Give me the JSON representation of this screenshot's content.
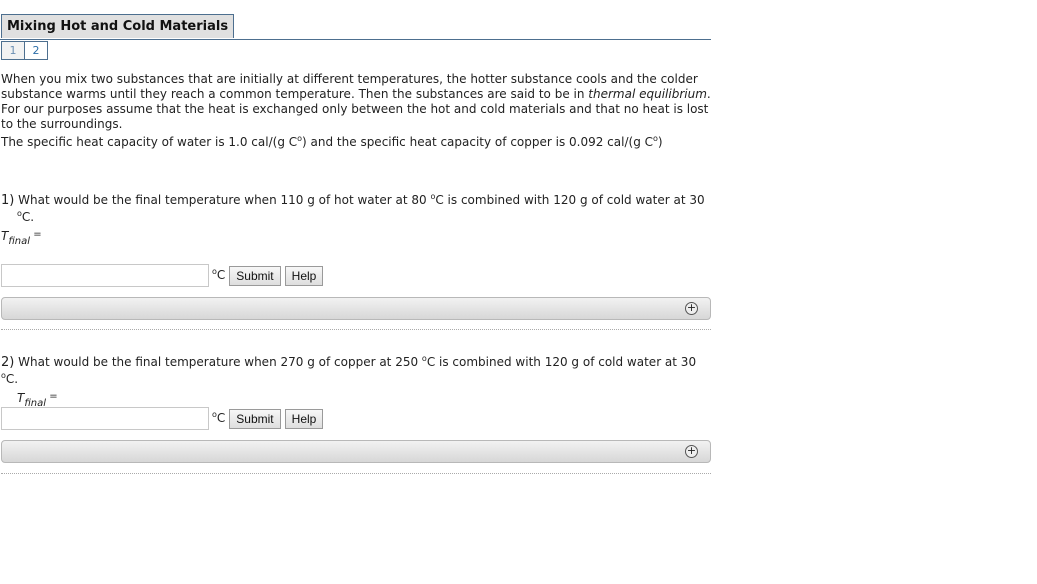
{
  "header": {
    "title": "Mixing Hot and Cold Materials"
  },
  "parts": [
    {
      "label": "1",
      "active": true
    },
    {
      "label": "2",
      "active": false
    }
  ],
  "intro": {
    "p1_before": "When you mix two substances that are initially at different temperatures, the hotter substance cools and the colder substance warms until they reach a common temperature. Then the substances are said to be in ",
    "p1_italic": "thermal equilibrium",
    "p1_after": ". For our purposes assume that the heat is exchanged only between the hot and cold materials and that no heat is lost to the surroundings.",
    "p2_a": "The specific heat capacity of water is 1.0 cal/(g C",
    "p2_b": ") and the specific heat capacity of copper is 0.092 cal/(g C",
    "p2_c": ")",
    "degree": "o"
  },
  "questions": [
    {
      "number": "1)",
      "text_a": " What would be the final temperature when 110 g of hot water at 80 ",
      "text_b": "C is combined with 120 g of cold water at 30",
      "text_c": "C.",
      "var_T": "T",
      "var_sub": "final",
      "equals": " =",
      "answer_value": "",
      "unit_deg": "o",
      "unit": "C",
      "submit_label": "Submit",
      "help_label": "Help",
      "expand_icon": "plus-circle-icon"
    },
    {
      "number": "2)",
      "text_a": " What would be the final temperature when 270 g of copper at 250 ",
      "text_b": "C is combined with 120 g of cold water at 30 ",
      "text_c": "C.",
      "var_T": "T",
      "var_sub": "final",
      "equals": " =",
      "answer_value": "",
      "unit_deg": "o",
      "unit": "C",
      "submit_label": "Submit",
      "help_label": "Help",
      "expand_icon": "plus-circle-icon"
    }
  ],
  "symbols": {
    "degree": "o",
    "plus": "+"
  }
}
